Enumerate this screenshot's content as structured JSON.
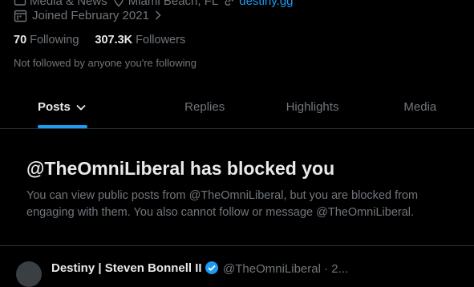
{
  "profile": {
    "category": "Media & News",
    "location": "Miami Beach, FL",
    "website": "destiny.gg",
    "joined": "Joined February 2021",
    "following_count": "70",
    "following_label": "Following",
    "followers_count": "307.3K",
    "followers_label": "Followers",
    "not_followed_text": "Not followed by anyone you're following"
  },
  "tabs": [
    {
      "label": "Posts"
    },
    {
      "label": "Replies"
    },
    {
      "label": "Highlights"
    },
    {
      "label": "Media"
    }
  ],
  "blocked": {
    "title": "@TheOmniLiberal has blocked you",
    "description": "You can view public posts from @TheOmniLiberal, but you are blocked from engaging with them. You also cannot follow or message @TheOmniLiberal."
  },
  "next_post": {
    "name": "Destiny | Steven Bonnell II",
    "handle": "@TheOmniLiberal · 2..."
  },
  "colors": {
    "accent": "#1d9bf0",
    "muted": "#71767b",
    "text": "#e7e9ea",
    "border": "#2f3336"
  },
  "icons": {
    "category": "briefcase-icon",
    "location": "location-pin-icon",
    "website": "link-icon",
    "joined": "calendar-icon",
    "tab_menu": "chevron-down-icon",
    "verified": "verified-badge-icon"
  }
}
